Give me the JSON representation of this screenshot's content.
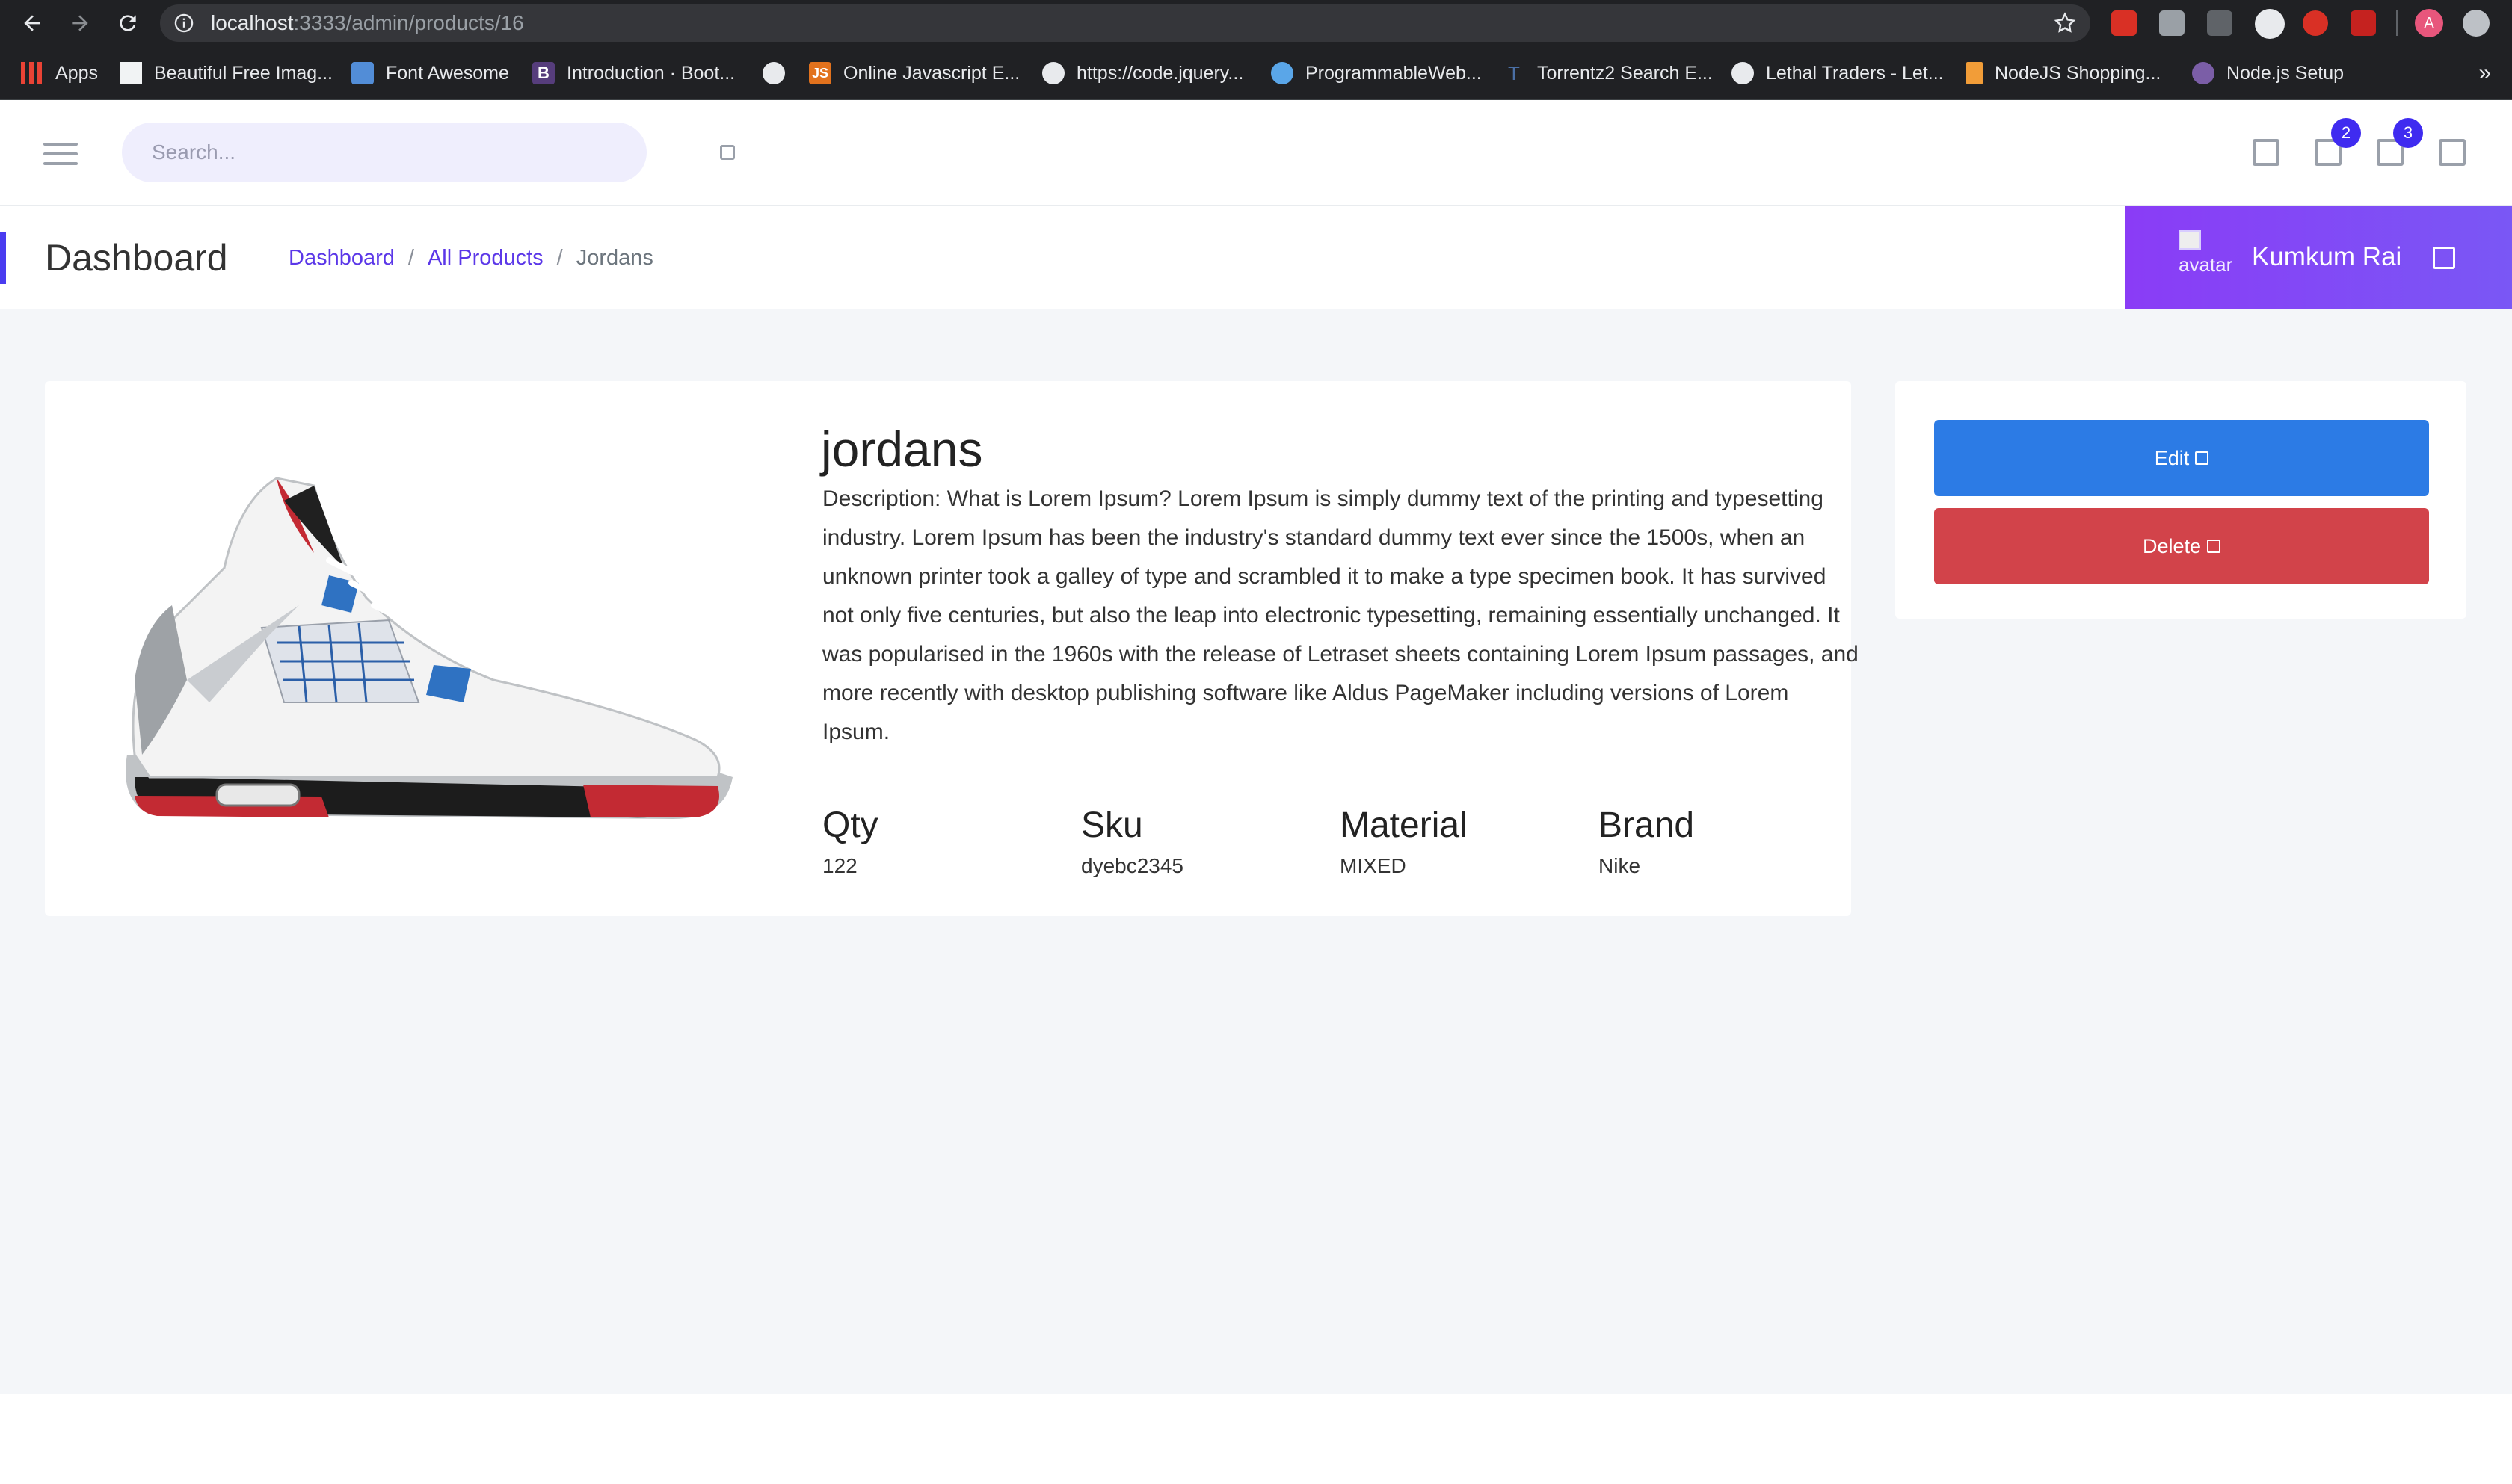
{
  "browser": {
    "url_host": "localhost",
    "url_path": ":3333/admin/products/16",
    "bookmarks": [
      {
        "label": "Apps",
        "icon": "apps-grid-icon"
      },
      {
        "label": "Beautiful Free Imag...",
        "icon": "unsplash-icon"
      },
      {
        "label": "Font Awesome",
        "icon": "flag-icon"
      },
      {
        "label": "Introduction · Boot...",
        "icon": "bootstrap-icon"
      },
      {
        "label": "",
        "icon": "globe-icon"
      },
      {
        "label": "Online Javascript E...",
        "icon": "js-icon"
      },
      {
        "label": "https://code.jquery...",
        "icon": "globe-icon"
      },
      {
        "label": "ProgrammableWeb...",
        "icon": "gear-icon"
      },
      {
        "label": "Torrentz2 Search E...",
        "icon": "torrentz-icon"
      },
      {
        "label": "Lethal Traders - Let...",
        "icon": "globe-icon"
      },
      {
        "label": "NodeJS Shopping...",
        "icon": "bookmark-icon"
      },
      {
        "label": "Node.js Setup",
        "icon": "flower-icon"
      }
    ],
    "profile_initial": "A"
  },
  "header": {
    "search_placeholder": "Search...",
    "notifications": [
      {
        "icon": "square-icon",
        "badge": ""
      },
      {
        "icon": "square-icon",
        "badge": "2"
      },
      {
        "icon": "square-icon",
        "badge": "3"
      },
      {
        "icon": "square-icon",
        "badge": ""
      }
    ]
  },
  "subheader": {
    "title": "Dashboard",
    "breadcrumb": [
      "Dashboard",
      "All Products",
      "Jordans"
    ],
    "user_name": "Kumkum Rai",
    "avatar_alt": "avatar"
  },
  "product": {
    "name": "jordans",
    "description": "Description: What is Lorem Ipsum? Lorem Ipsum is simply dummy text of the printing and typesetting industry. Lorem Ipsum has been the industry's standard dummy text ever since the 1500s, when an unknown printer took a galley of type and scrambled it to make a type specimen book. It has survived not only five centuries, but also the leap into electronic typesetting, remaining essentially unchanged. It was popularised in the 1960s with the release of Letraset sheets containing Lorem Ipsum passages, and more recently with desktop publishing software like Aldus PageMaker including versions of Lorem Ipsum.",
    "specs": [
      {
        "label": "Qty",
        "value": "122"
      },
      {
        "label": "Sku",
        "value": "dyebc2345"
      },
      {
        "label": "Material",
        "value": "MIXED"
      },
      {
        "label": "Brand",
        "value": "Nike"
      }
    ]
  },
  "actions": {
    "edit_label": "Edit",
    "delete_label": "Delete"
  },
  "colors": {
    "accent": "#4a3cf0",
    "edit": "#2c7be5",
    "delete": "#d2434a"
  }
}
